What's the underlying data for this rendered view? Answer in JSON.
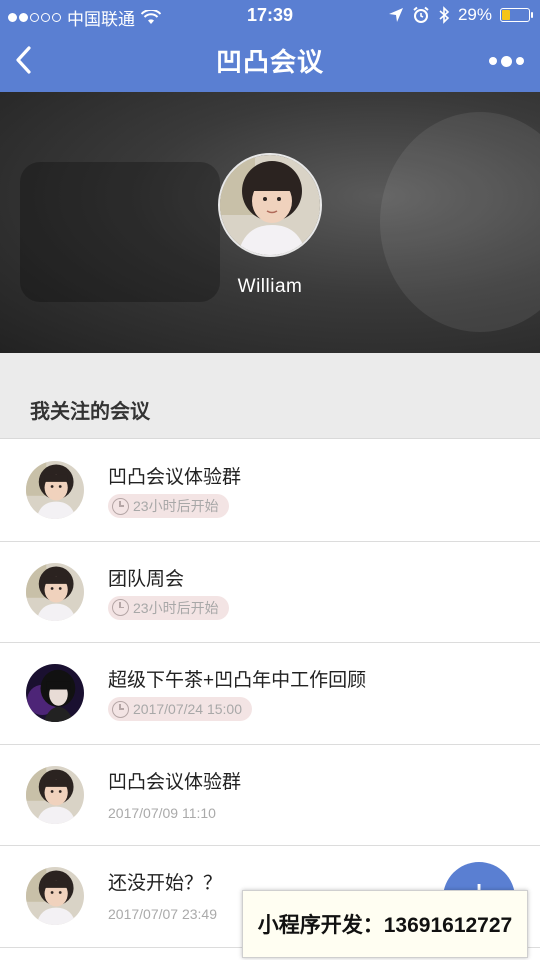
{
  "status_bar": {
    "carrier": "中国联通",
    "time": "17:39",
    "battery_percent": "29%",
    "battery_level": 0.29,
    "battery_color": "#f5c518",
    "icons": [
      "signal-dots-icon",
      "wifi-icon",
      "location-arrow-icon",
      "alarm-icon",
      "bluetooth-icon",
      "battery-icon"
    ]
  },
  "nav": {
    "title": "凹凸会议",
    "back_icon": "chevron-left-icon",
    "more_icon": "more-dots-icon",
    "accent": "#5a7fd2"
  },
  "profile": {
    "name": "William"
  },
  "section": {
    "title": "我关注的会议"
  },
  "meetings": [
    {
      "title": "凹凸会议体验群",
      "time": "23小时后开始",
      "style": "pill",
      "avatar": "girl"
    },
    {
      "title": "团队周会",
      "time": "23小时后开始",
      "style": "pill",
      "avatar": "girl"
    },
    {
      "title": "超级下午茶+凹凸年中工作回顾",
      "time": "2017/07/24 15:00",
      "style": "pill",
      "avatar": "boy"
    },
    {
      "title": "凹凸会议体验群",
      "time": "2017/07/09 11:10",
      "style": "plain",
      "avatar": "girl"
    },
    {
      "title": "还没开始？？",
      "time": "2017/07/07 23:49",
      "style": "plain",
      "avatar": "girl"
    }
  ],
  "fab": {
    "label": "+"
  },
  "banner": {
    "text": "小程序开发：13691612727"
  }
}
